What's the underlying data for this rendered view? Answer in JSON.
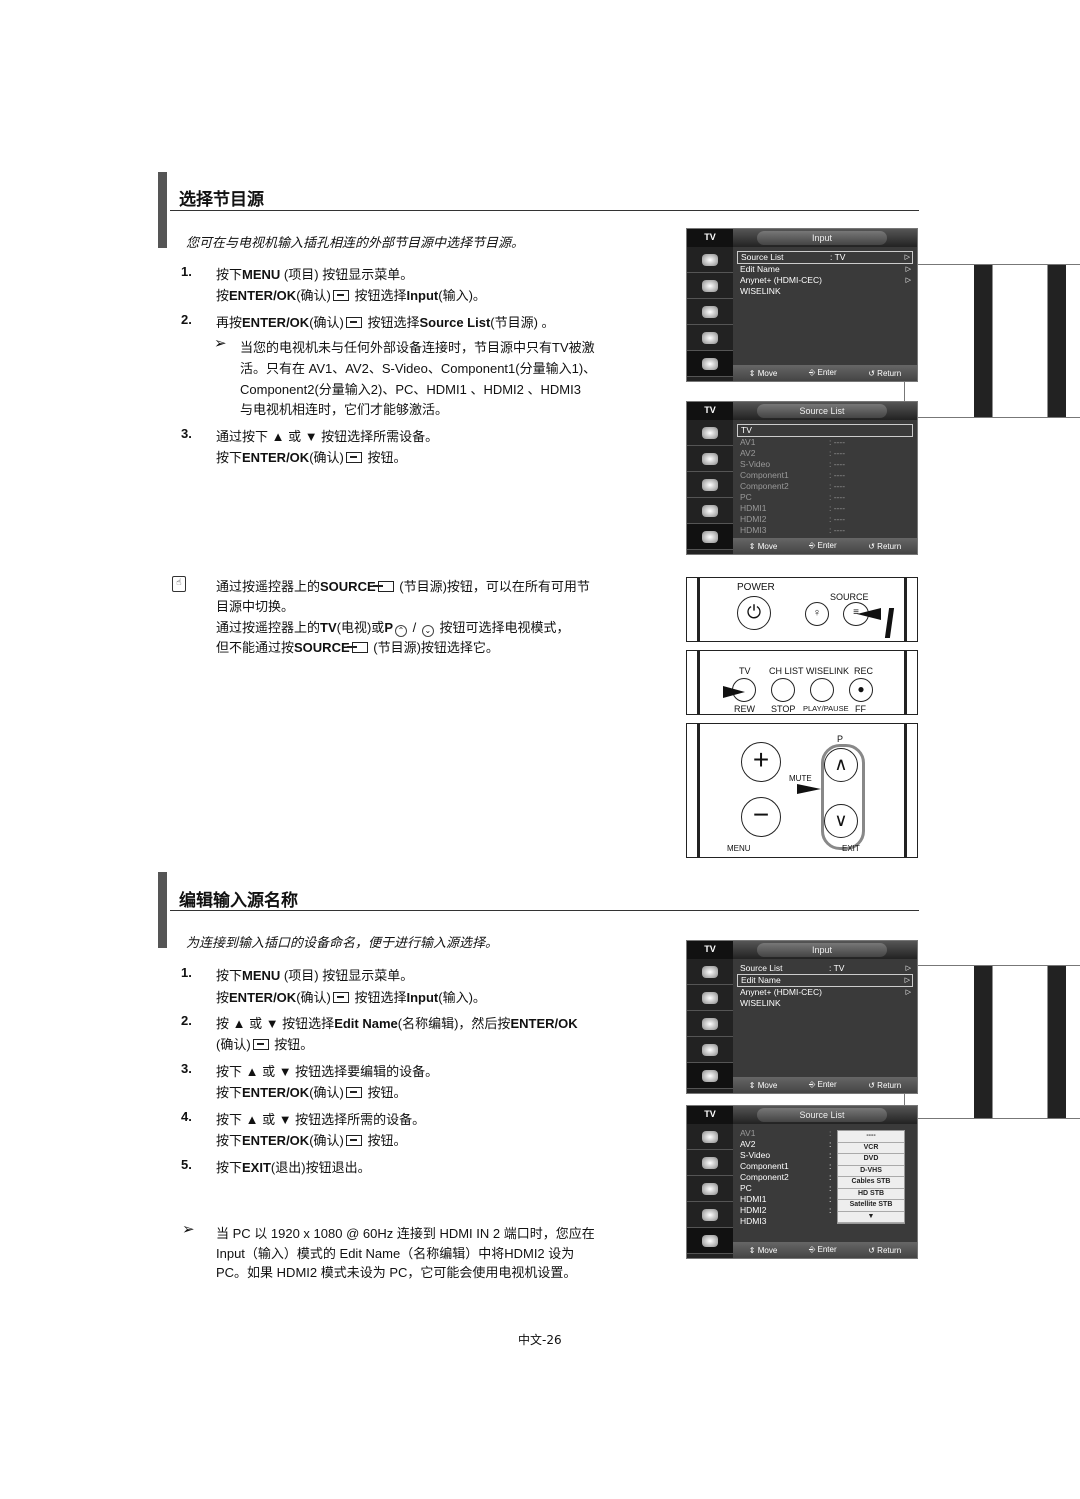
{
  "section1": {
    "title": "选择节目源",
    "subtitle": "您可在与电视机输入插孔相连的外部节目源中选择节目源。",
    "steps": [
      {
        "num": "1.",
        "lines": [
          [
            {
              "t": "按下"
            },
            {
              "b": "MENU"
            },
            {
              "t": " (项目)"
            },
            {
              "i": "menu"
            },
            {
              "t": " 按钮显示菜单。"
            }
          ],
          [
            {
              "t": "按"
            },
            {
              "b": "ENTER/OK"
            },
            {
              "t": "(确认)"
            },
            {
              "i": "enter"
            },
            {
              "t": " 按钮选择"
            },
            {
              "b": "Input"
            },
            {
              "t": "(输入)。"
            }
          ]
        ]
      },
      {
        "num": "2.",
        "lines": [
          [
            {
              "t": "再按"
            },
            {
              "b": "ENTER/OK"
            },
            {
              "t": "(确认)"
            },
            {
              "i": "enter"
            },
            {
              "t": " 按钮选择"
            },
            {
              "b": "Source List"
            },
            {
              "t": "(节目源) 。"
            }
          ]
        ]
      },
      {
        "num": "3.",
        "lines": [
          [
            {
              "t": "通过按下 ▲ 或 ▼ 按钮选择所需设备。"
            }
          ],
          [
            {
              "t": "按下"
            },
            {
              "b": "ENTER/OK"
            },
            {
              "t": "(确认)"
            },
            {
              "i": "enter"
            },
            {
              "t": " 按钮。"
            }
          ]
        ]
      }
    ],
    "tip": [
      [
        {
          "t": "当您的电视机未与任何外部设备连接时，节目源中只有TV被激"
        }
      ],
      [
        {
          "t": "活。只有在 AV1、AV2、S-Video、Component1(分量输入1)、"
        }
      ],
      [
        {
          "t": "Component2(分量输入2)、PC、HDMI1 、HDMI2 、HDMI3"
        }
      ],
      [
        {
          "t": "与电视机相连时，它们才能够激活。"
        }
      ]
    ],
    "note": [
      [
        {
          "t": "通过按遥控器上的"
        },
        {
          "b": "SOURCE"
        },
        {
          "i": "src"
        },
        {
          "t": " (节目源)按钮，可以在所有可用节"
        }
      ],
      [
        {
          "t": "目源中切换。"
        }
      ],
      [
        {
          "t": "通过按遥控器上的"
        },
        {
          "b": "TV"
        },
        {
          "t": "(电视)或"
        },
        {
          "b": "P"
        },
        {
          "i": "up"
        },
        {
          "t": " / "
        },
        {
          "i": "down"
        },
        {
          "t": " 按钮可选择电视模式，"
        }
      ],
      [
        {
          "t": "但不能通过按"
        },
        {
          "b": "SOURCE"
        },
        {
          "i": "src"
        },
        {
          "t": " (节目源)按钮选择它。"
        }
      ]
    ]
  },
  "section2": {
    "title": "编辑输入源名称",
    "subtitle": "为连接到输入插口的设备命名，便于进行输入源选择。",
    "steps": [
      {
        "num": "1.",
        "lines": [
          [
            {
              "t": "按下"
            },
            {
              "b": "MENU"
            },
            {
              "t": " (项目)"
            },
            {
              "i": "menu"
            },
            {
              "t": " 按钮显示菜单。"
            }
          ],
          [
            {
              "t": "按"
            },
            {
              "b": "ENTER/OK"
            },
            {
              "t": "(确认)"
            },
            {
              "i": "enter"
            },
            {
              "t": " 按钮选择"
            },
            {
              "b": "Input"
            },
            {
              "t": "(输入)。"
            }
          ]
        ]
      },
      {
        "num": "2.",
        "lines": [
          [
            {
              "t": "按 ▲ 或 ▼ 按钮选择"
            },
            {
              "b": "Edit Name"
            },
            {
              "t": "(名称编辑)，然后按"
            },
            {
              "b": "ENTER/OK"
            }
          ],
          [
            {
              "t": "(确认)"
            },
            {
              "i": "enter"
            },
            {
              "t": " 按钮。"
            }
          ]
        ]
      },
      {
        "num": "3.",
        "lines": [
          [
            {
              "t": "按下 ▲ 或 ▼ 按钮选择要编辑的设备。"
            }
          ],
          [
            {
              "t": "按下"
            },
            {
              "b": "ENTER/OK"
            },
            {
              "t": "(确认)"
            },
            {
              "i": "enter"
            },
            {
              "t": " 按钮。"
            }
          ]
        ]
      },
      {
        "num": "4.",
        "lines": [
          [
            {
              "t": "按下 ▲ 或 ▼ 按钮选择所需的设备。"
            }
          ],
          [
            {
              "t": "按下"
            },
            {
              "b": "ENTER/OK"
            },
            {
              "t": "(确认)"
            },
            {
              "i": "enter"
            },
            {
              "t": " 按钮。"
            }
          ]
        ]
      },
      {
        "num": "5.",
        "lines": [
          [
            {
              "t": "按下"
            },
            {
              "b": "EXIT"
            },
            {
              "t": "(退出)按钮退出。"
            }
          ]
        ]
      }
    ],
    "tip": [
      [
        {
          "t": "当 PC 以 1920 x 1080 @ 60Hz 连接到 HDMI IN 2 端口时，您应在"
        }
      ],
      [
        {
          "t": "Input（输入）模式的 Edit Name（名称编辑）中将HDMI2 设为"
        }
      ],
      [
        {
          "t": "PC。如果 HDMI2 模式未设为 PC，它可能会使用电视机设置。"
        }
      ]
    ]
  },
  "menus": [
    {
      "tab": "TV",
      "title": "Input",
      "items": [
        {
          "label": "Source List",
          "value": ": TV",
          "arrow": "▷",
          "sel": true
        },
        {
          "label": "Edit Name",
          "arrow": "▷"
        },
        {
          "label": "Anynet+ (HDMI-CEC)",
          "arrow": "▷"
        },
        {
          "label": "WISELINK"
        }
      ],
      "footer": [
        "⇕ Move",
        "⎆ Enter",
        "↺ Return"
      ]
    },
    {
      "tab": "TV",
      "title": "Source List",
      "items": [
        {
          "label": "TV",
          "sel": true
        },
        {
          "label": "AV1",
          "value": ": ----",
          "dim": true
        },
        {
          "label": "AV2",
          "value": ": ----",
          "dim": true
        },
        {
          "label": "S-Video",
          "value": ": ----",
          "dim": true
        },
        {
          "label": "Component1",
          "value": ": ----",
          "dim": true
        },
        {
          "label": "Component2",
          "value": ": ----",
          "dim": true
        },
        {
          "label": "PC",
          "value": ": ----",
          "dim": true
        },
        {
          "label": "HDMI1",
          "value": ": ----",
          "dim": true
        },
        {
          "label": "HDMI2",
          "value": ": ----",
          "dim": true
        },
        {
          "label": "HDMI3",
          "value": ": ----",
          "dim": true
        }
      ],
      "footer": [
        "⇕ Move",
        "⎆ Enter",
        "↺ Return"
      ]
    },
    {
      "tab": "TV",
      "title": "Input",
      "items": [
        {
          "label": "Source List",
          "value": ": TV",
          "arrow": "▷"
        },
        {
          "label": "Edit Name",
          "arrow": "▷",
          "sel": true
        },
        {
          "label": "Anynet+ (HDMI-CEC)",
          "arrow": "▷"
        },
        {
          "label": "WISELINK"
        }
      ],
      "footer": [
        "⇕ Move",
        "⎆ Enter",
        "↺ Return"
      ]
    },
    {
      "tab": "TV",
      "title": "Source List",
      "items": [
        {
          "label": "AV1",
          "value": ":",
          "dim": true
        },
        {
          "label": "AV2",
          "value": ":"
        },
        {
          "label": "S-Video",
          "value": ":"
        },
        {
          "label": "Component1",
          "value": ":"
        },
        {
          "label": "Component2",
          "value": ":"
        },
        {
          "label": "PC",
          "value": ":"
        },
        {
          "label": "HDMI1",
          "value": ":"
        },
        {
          "label": "HDMI2",
          "value": ":"
        },
        {
          "label": "HDMI3"
        }
      ],
      "popup": [
        "----",
        "VCR",
        "DVD",
        "D-VHS",
        "Cables STB",
        "HD STB",
        "Satellite STB",
        "▼"
      ],
      "footer": [
        "⇕ Move",
        "⎆ Enter",
        "↺ Return"
      ]
    }
  ],
  "remote": {
    "power": "POWER",
    "source": "SOURCE",
    "row_top": [
      "TV",
      "CH LIST",
      "WISELINK",
      "REC"
    ],
    "row_bottom": [
      "REW",
      "STOP",
      "PLAY/PAUSE",
      "FF"
    ],
    "p": "P",
    "mute": "MUTE",
    "menu": "MENU",
    "exit": "EXIT"
  },
  "page_number": "中文-26"
}
